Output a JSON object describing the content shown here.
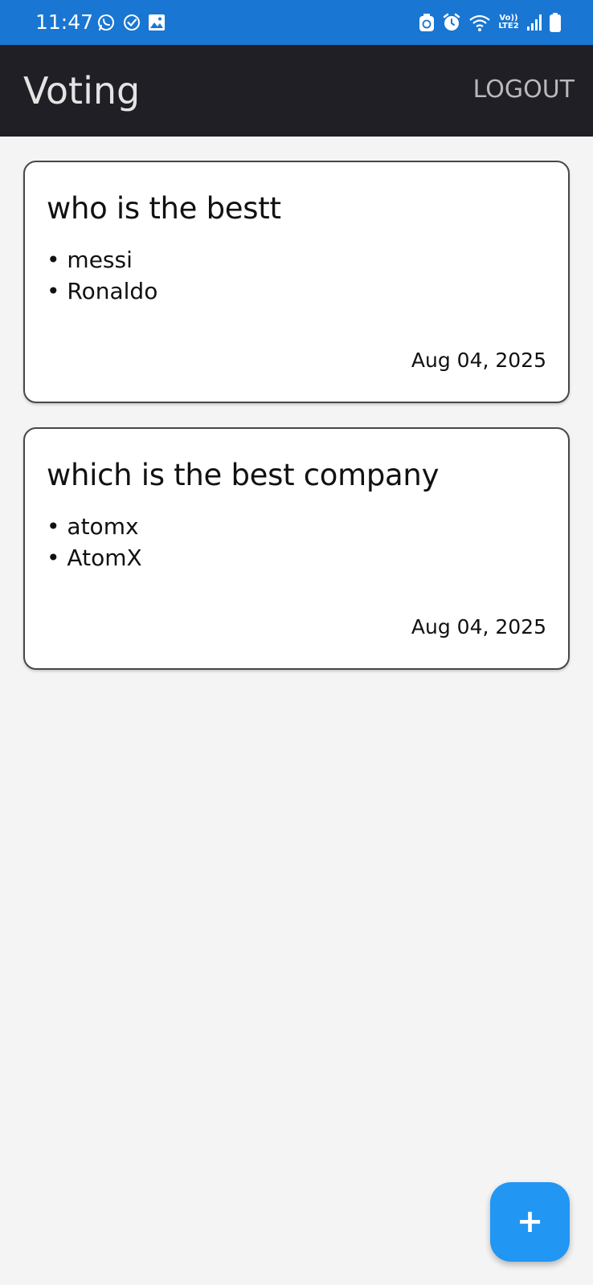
{
  "status_bar": {
    "time": "11:47",
    "lte_label_top": "Vo))",
    "lte_label_bottom": "LTE2",
    "icons": [
      "whatsapp-icon",
      "check-circle-icon",
      "gallery-icon",
      "recycle-icon",
      "alarm-icon",
      "wifi-icon",
      "signal-icon",
      "battery-icon"
    ]
  },
  "app_bar": {
    "title": "Voting",
    "logout_label": "LOGOUT"
  },
  "polls": [
    {
      "question": "who is the bestt",
      "options": [
        "messi",
        "Ronaldo"
      ],
      "date": "Aug 04, 2025"
    },
    {
      "question": "which is the best company",
      "options": [
        "atomx",
        "AtomX"
      ],
      "date": "Aug 04, 2025"
    }
  ],
  "fab": {
    "label": "+"
  },
  "colors": {
    "status_bar": "#1976d2",
    "app_bar": "#1f1f25",
    "background": "#f4f4f4",
    "fab": "#2196f3"
  }
}
